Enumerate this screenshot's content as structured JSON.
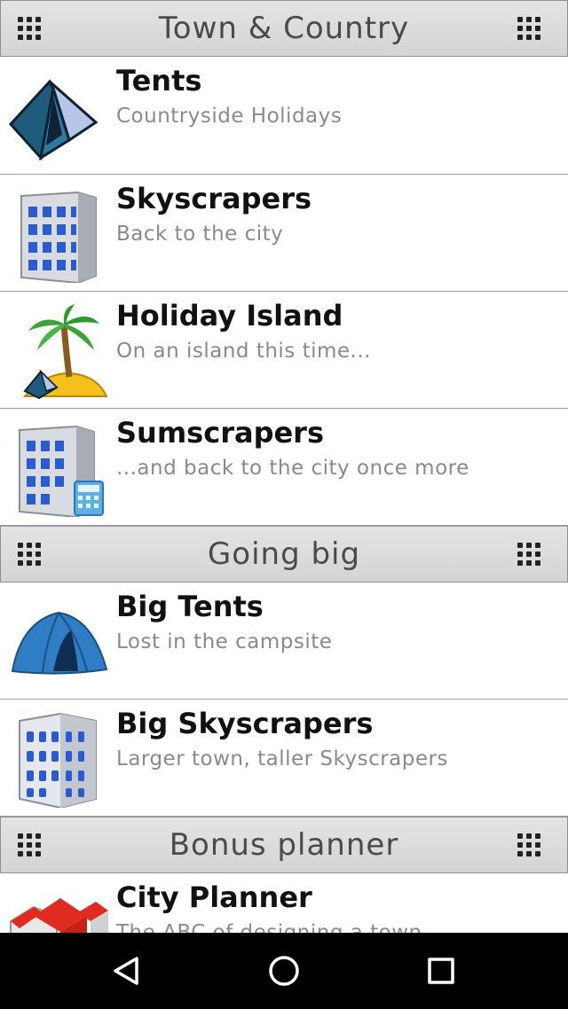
{
  "sections": [
    {
      "header": "Town & Country",
      "items": [
        {
          "title": "Tents",
          "subtitle": "Countryside Holidays",
          "icon": "tent-icon"
        },
        {
          "title": "Skyscrapers",
          "subtitle": "Back to the city",
          "icon": "skyscraper-icon"
        },
        {
          "title": "Holiday Island",
          "subtitle": "On an island this time...",
          "icon": "island-icon"
        },
        {
          "title": "Sumscrapers",
          "subtitle": "...and back to the city once more",
          "icon": "sumscraper-icon"
        }
      ]
    },
    {
      "header": "Going big",
      "items": [
        {
          "title": "Big Tents",
          "subtitle": "Lost in the campsite",
          "icon": "dome-tent-icon"
        },
        {
          "title": "Big Skyscrapers",
          "subtitle": "Larger town, taller Skyscrapers",
          "icon": "big-skyscraper-icon"
        }
      ]
    },
    {
      "header": "Bonus planner",
      "items": [
        {
          "title": "City Planner",
          "subtitle": "The ABC of designing a town",
          "icon": "city-planner-icon"
        }
      ]
    }
  ],
  "navbar": {
    "back": "back-icon",
    "home": "home-icon",
    "recents": "recents-icon"
  }
}
